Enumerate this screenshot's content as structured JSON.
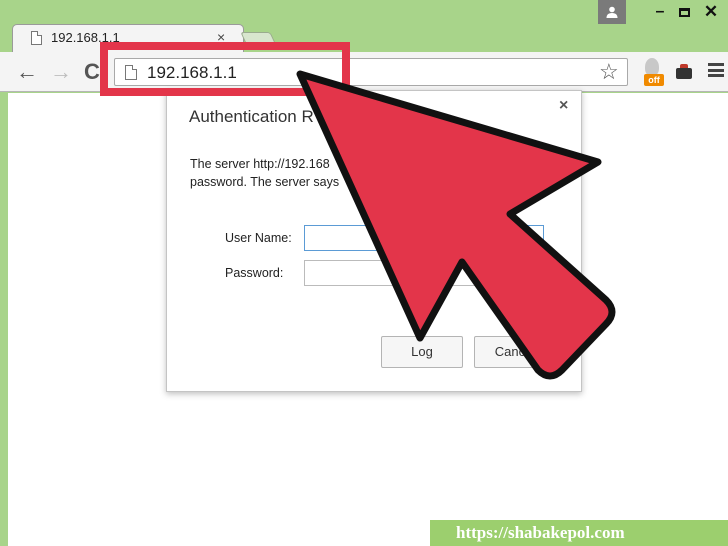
{
  "window": {
    "user_icon": "user-icon",
    "min_glyph": "–",
    "close_glyph": "✕"
  },
  "tab": {
    "title": "192.168.1.1",
    "close_glyph": "×"
  },
  "toolbar": {
    "back_glyph": "←",
    "forward_glyph": "→",
    "reload_glyph": "C",
    "url": "192.168.1.1",
    "star_glyph": "☆",
    "ext_badge": "off"
  },
  "dialog": {
    "title": "Authentication R",
    "close_glyph": "×",
    "message_line1": "The server http://192.168",
    "message_line2": "password. The server says",
    "username_label": "User Name:",
    "password_label": "Password:",
    "username_value": "",
    "password_value": "",
    "login_label": "Log",
    "cancel_label": "Cancel"
  },
  "annotation": {
    "highlight_color": "#e3354a",
    "arrow_color": "#e3354a"
  },
  "watermark": {
    "text": "https://shabakepol.com"
  }
}
